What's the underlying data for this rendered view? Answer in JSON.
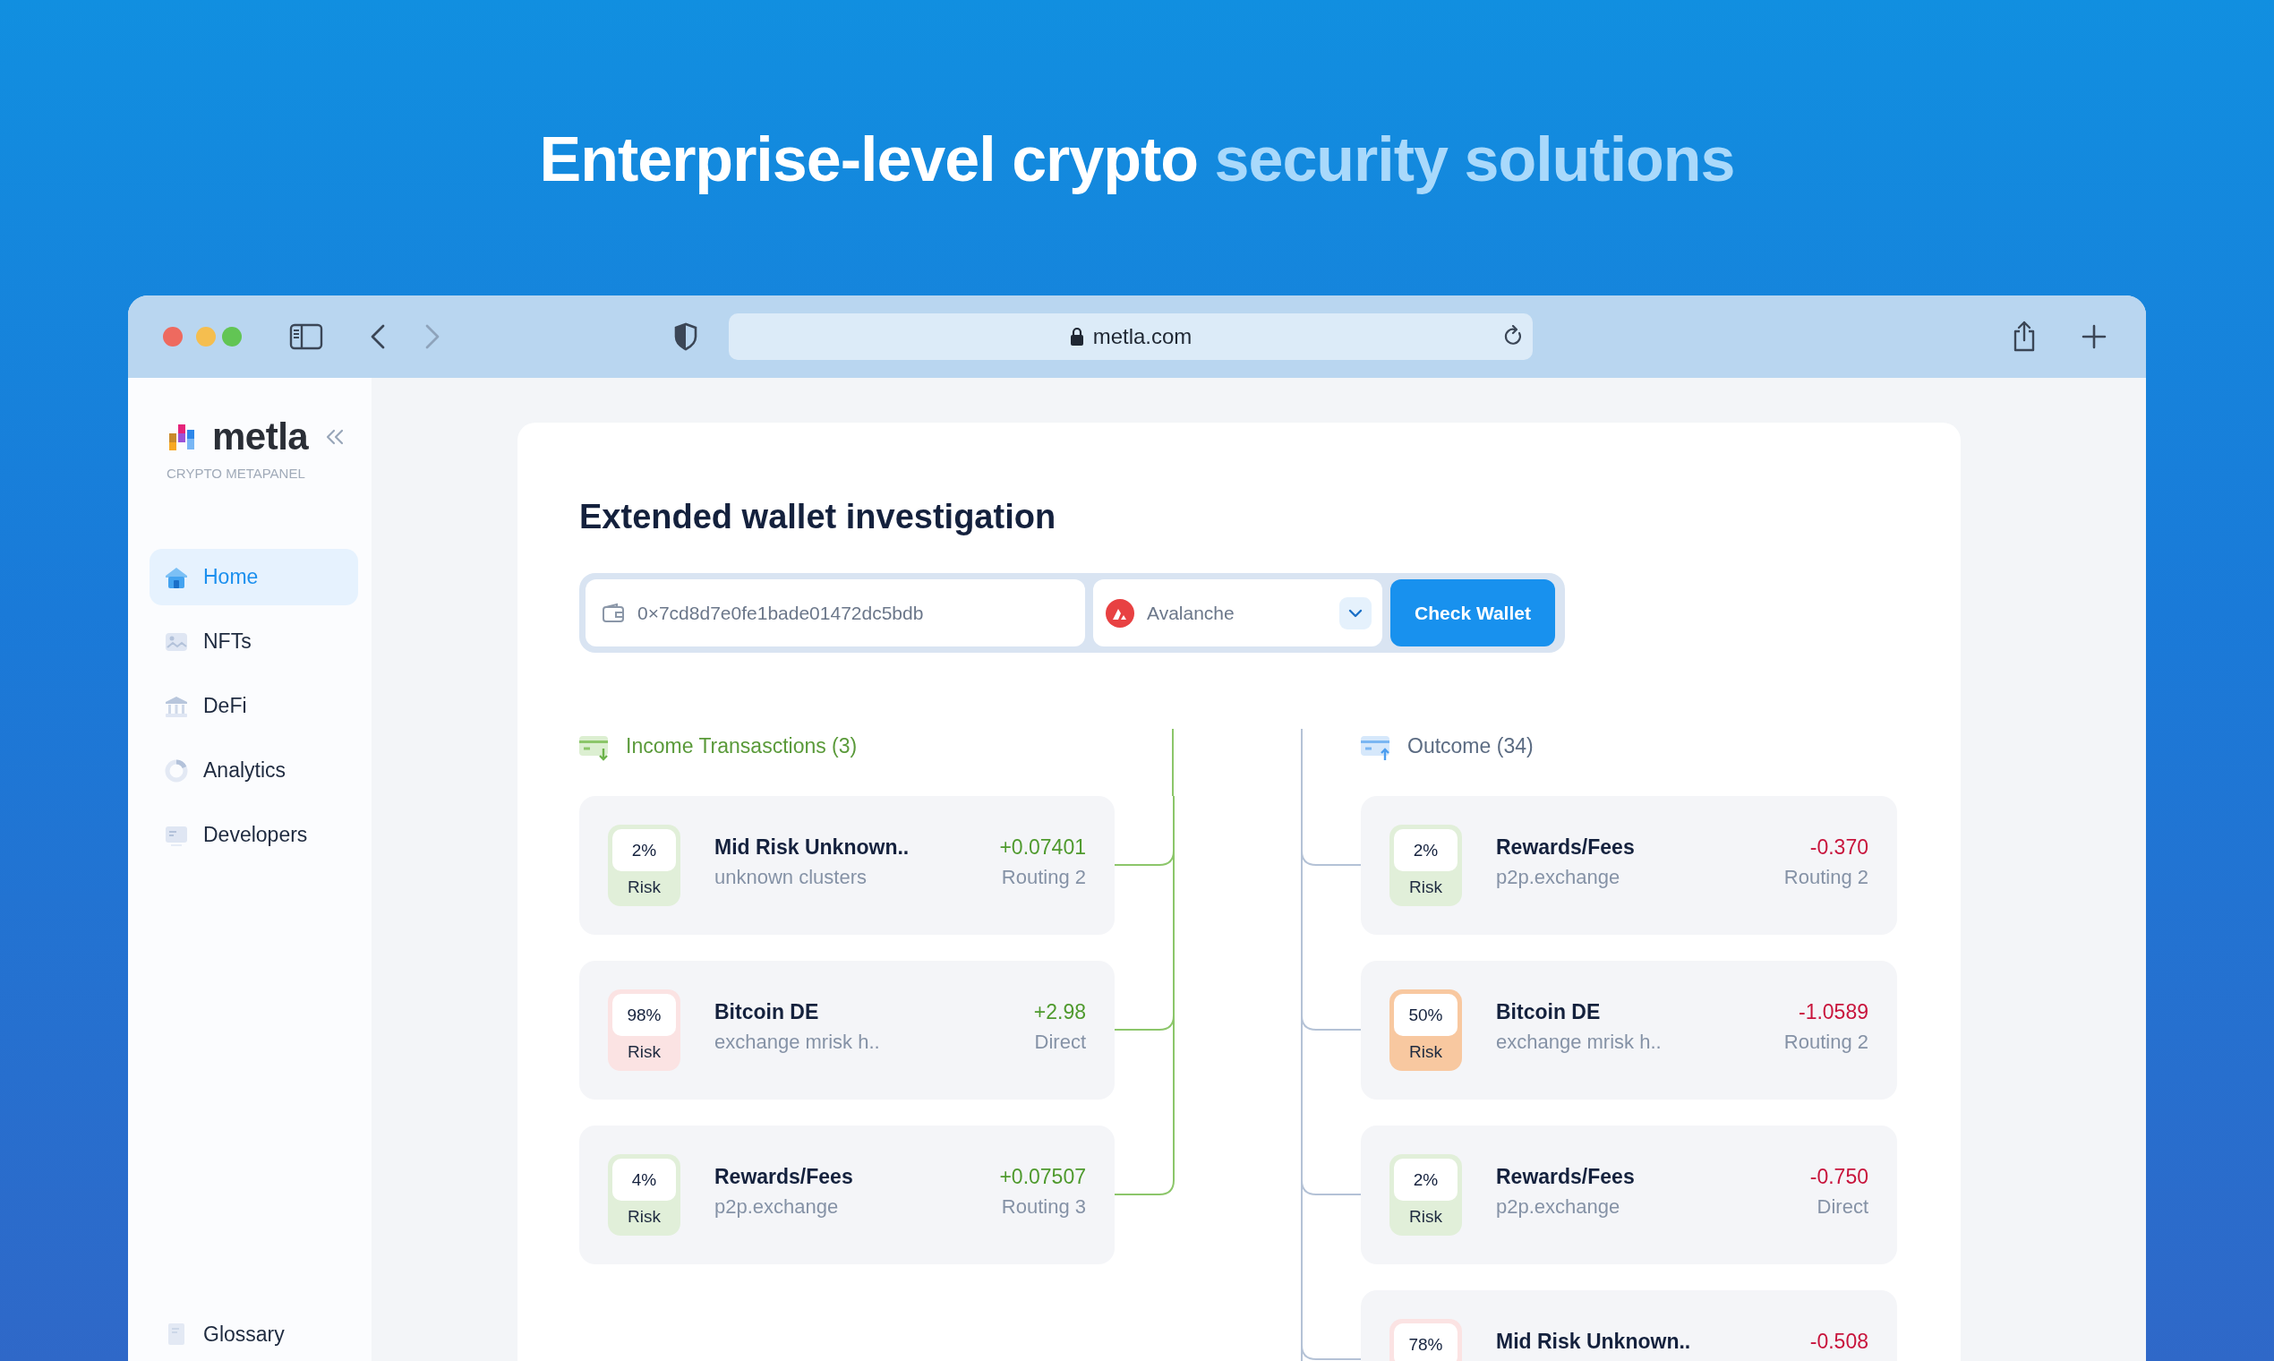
{
  "headline": {
    "text": "Enterprise-level crypto",
    "highlight": "security solutions"
  },
  "browser": {
    "url": "metla.com"
  },
  "sidebar": {
    "brand": "metla",
    "subtitle": "CRYPTO METAPANEL",
    "items": [
      {
        "label": "Home",
        "selected": true
      },
      {
        "label": "NFTs",
        "selected": false
      },
      {
        "label": "DeFi",
        "selected": false
      },
      {
        "label": "Analytics",
        "selected": false
      },
      {
        "label": "Developers",
        "selected": false
      }
    ],
    "footer_item": {
      "label": "Glossary"
    }
  },
  "main": {
    "title": "Extended wallet investigation",
    "wallet_field": {
      "value": "0×7cd8d7e0fe1bade01472dc5bdb"
    },
    "network_select": {
      "value": "Avalanche"
    },
    "check_button": "Check Wallet",
    "sections": [
      {
        "kind": "income",
        "title": "Income Transasctions",
        "count": "(3)",
        "items": [
          {
            "risk": "2%",
            "risk_label": "Risk",
            "color": "#e1efd9",
            "name": "Mid Risk Unknown..",
            "detail": "unknown clusters",
            "amount": "+0.07401",
            "route": "Routing 2"
          },
          {
            "risk": "98%",
            "risk_label": "Risk",
            "color": "#fbe3e3",
            "name": "Bitcoin DE",
            "detail": "exchange mrisk h..",
            "amount": "+2.98",
            "route": "Direct"
          },
          {
            "risk": "4%",
            "risk_label": "Risk",
            "color": "#e1efd9",
            "name": "Rewards/Fees",
            "detail": "p2p.exchange",
            "amount": "+0.07507",
            "route": "Routing 3"
          }
        ]
      },
      {
        "kind": "outcome",
        "title": "Outcome",
        "count": "(34)",
        "items": [
          {
            "risk": "2%",
            "risk_label": "Risk",
            "color": "#e1efd9",
            "name": "Rewards/Fees",
            "detail": "p2p.exchange",
            "amount": "-0.370",
            "route": "Routing 2"
          },
          {
            "risk": "50%",
            "risk_label": "Risk",
            "color": "#f8c8a0",
            "name": "Bitcoin DE",
            "detail": "exchange mrisk h..",
            "amount": "-1.0589",
            "route": "Routing 2"
          },
          {
            "risk": "2%",
            "risk_label": "Risk",
            "color": "#e1efd9",
            "name": "Rewards/Fees",
            "detail": "p2p.exchange",
            "amount": "-0.750",
            "route": "Direct"
          },
          {
            "risk": "78%",
            "color": "#fbe3e3",
            "name": "Mid Risk Unknown..",
            "amount": "-0.508"
          }
        ]
      }
    ]
  }
}
